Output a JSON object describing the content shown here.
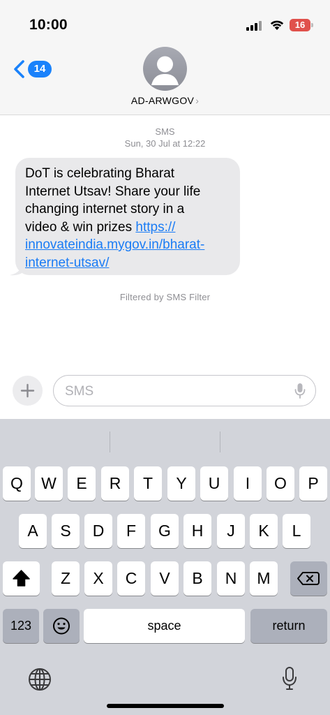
{
  "status_bar": {
    "time": "10:00",
    "battery": "16"
  },
  "header": {
    "unread_count": "14",
    "contact_name": "AD-ARWGOV",
    "contact_chevron": "›"
  },
  "thread": {
    "message_type": "SMS",
    "timestamp": "Sun, 30 Jul at 12:22",
    "messages": [
      {
        "direction": "incoming",
        "lines": [
          "DoT is celebrating Bharat",
          "Internet Utsav! Share your life",
          "changing internet story in a"
        ],
        "prefix_last": "video & win prizes ",
        "link_lines": [
          "https://",
          "innovateindia.mygov.in/bharat-",
          "internet-utsav/"
        ]
      }
    ],
    "filter_note": "Filtered by SMS Filter"
  },
  "compose": {
    "placeholder": "SMS"
  },
  "keyboard": {
    "row1": [
      "Q",
      "W",
      "E",
      "R",
      "T",
      "Y",
      "U",
      "I",
      "O",
      "P"
    ],
    "row2": [
      "A",
      "S",
      "D",
      "F",
      "G",
      "H",
      "J",
      "K",
      "L"
    ],
    "row3": [
      "Z",
      "X",
      "C",
      "V",
      "B",
      "N",
      "M"
    ],
    "numbers_label": "123",
    "space_label": "space",
    "return_label": "return"
  },
  "icons": {
    "back": "chevron-left-icon",
    "avatar": "person-icon",
    "add": "plus-icon",
    "mic": "microphone-icon",
    "shift": "shift-arrow-icon",
    "delete": "backspace-icon",
    "emoji": "emoji-icon",
    "globe": "globe-icon",
    "dictation": "microphone-icon"
  },
  "colors": {
    "accent": "#1a82fb",
    "battery_low": "#e0514c",
    "bubble": "#e9e9eb",
    "keyboard_bg": "#d2d4da"
  }
}
